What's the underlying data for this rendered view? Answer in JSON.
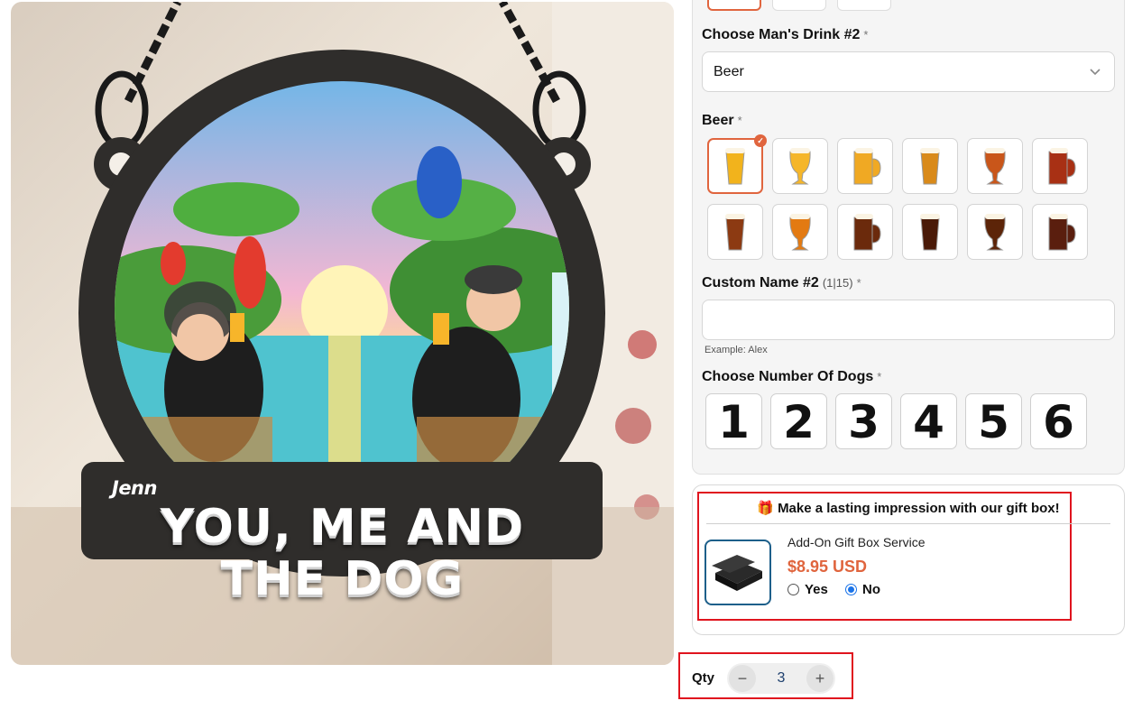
{
  "product_image": {
    "name_on_sign": "Jenn",
    "headline_line1": "YOU, ME AND",
    "headline_line2": "THE DOG"
  },
  "drink_field": {
    "label": "Choose Man's Drink #2",
    "required_mark": "*",
    "selected_value": "Beer"
  },
  "beer_field": {
    "label": "Beer",
    "required_mark": "*",
    "selected_index": 0,
    "options": [
      {
        "icon": "pint-glass-lager-icon",
        "color": "#f2b31c"
      },
      {
        "icon": "tulip-glass-lager-icon",
        "color": "#f5b62a"
      },
      {
        "icon": "pilsner-glass-icon",
        "color": "#f0a923"
      },
      {
        "icon": "beer-mug-icon",
        "color": "#d98a1a"
      },
      {
        "icon": "amber-pint-icon",
        "color": "#c9561a"
      },
      {
        "icon": "red-ale-goblet-icon",
        "color": "#a83014"
      },
      {
        "icon": "brown-ale-pint-icon",
        "color": "#8c3a12"
      },
      {
        "icon": "orange-ale-pint-icon",
        "color": "#e37a12"
      },
      {
        "icon": "dark-ale-mug-icon",
        "color": "#6b2a0c"
      },
      {
        "icon": "stout-goblet-icon",
        "color": "#4a1a08"
      },
      {
        "icon": "porter-tulip-icon",
        "color": "#5c2408"
      },
      {
        "icon": "dark-pint-icon",
        "color": "#5a1e0e"
      }
    ]
  },
  "custom_name_field": {
    "label": "Custom Name #2",
    "counter": "(1|15)",
    "required_mark": "*",
    "value": "",
    "hint": "Example: Alex"
  },
  "dogs_field": {
    "label": "Choose Number Of Dogs",
    "required_mark": "*",
    "options": [
      "1",
      "2",
      "3",
      "4",
      "5",
      "6"
    ]
  },
  "gift_box": {
    "title": "Make a lasting impression with our gift box!",
    "service_name": "Add-On Gift Box Service",
    "price": "$8.95 USD",
    "yes_label": "Yes",
    "no_label": "No",
    "selected": "No"
  },
  "quantity": {
    "label": "Qty",
    "value": "3",
    "minus": "−",
    "plus": "+"
  },
  "colors": {
    "accent": "#e0653e",
    "highlight_box": "#e0141e",
    "radio_selected": "#1a73e8"
  }
}
